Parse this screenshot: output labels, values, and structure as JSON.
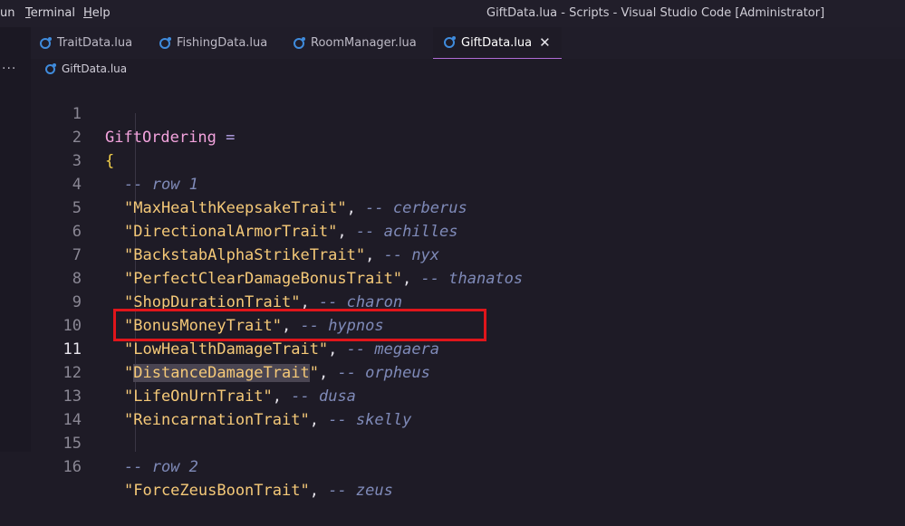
{
  "menu": [
    "un",
    "Terminal",
    "Help"
  ],
  "window_title": "GiftData.lua - Scripts - Visual Studio Code [Administrator]",
  "tabs": [
    {
      "label": "TraitData.lua"
    },
    {
      "label": "FishingData.lua"
    },
    {
      "label": "RoomManager.lua"
    },
    {
      "label": "GiftData.lua",
      "close": "✕"
    }
  ],
  "more_icon": "···",
  "breadcrumb": "GiftData.lua",
  "lines": [
    {
      "n": "1",
      "var": "GiftOrdering",
      "eq": " ="
    },
    {
      "n": "2",
      "brace": "{"
    },
    {
      "n": "3",
      "comment": "-- row 1"
    },
    {
      "n": "4",
      "str": "\"MaxHealthKeepsakeTrait\"",
      "comment": "-- cerberus"
    },
    {
      "n": "5",
      "str": "\"DirectionalArmorTrait\"",
      "comment": "-- achilles"
    },
    {
      "n": "6",
      "str": "\"BackstabAlphaStrikeTrait\"",
      "comment": "-- nyx"
    },
    {
      "n": "7",
      "str": "\"PerfectClearDamageBonusTrait\"",
      "comment": "-- thanatos"
    },
    {
      "n": "8",
      "str": "\"ShopDurationTrait\"",
      "comment": "-- charon"
    },
    {
      "n": "9",
      "str": "\"BonusMoneyTrait\"",
      "comment": "-- hypnos"
    },
    {
      "n": "10",
      "str": "\"LowHealthDamageTrait\"",
      "comment": "-- megaera"
    },
    {
      "n": "11",
      "q": "\"",
      "str": "DistanceDamageTrait",
      "q2": "\"",
      "comment": "-- orpheus"
    },
    {
      "n": "12",
      "str": "\"LifeOnUrnTrait\"",
      "comment": "-- dusa"
    },
    {
      "n": "13",
      "str": "\"ReincarnationTrait\"",
      "comment": "-- skelly"
    },
    {
      "n": "14"
    },
    {
      "n": "15",
      "comment": "-- row 2"
    },
    {
      "n": "16",
      "str": "\"ForceZeusBoonTrait\"",
      "comment": "-- zeus"
    }
  ],
  "comma": ",",
  "colors": {
    "highlight_box": "#e0151b",
    "accent": "#b06bd6"
  }
}
